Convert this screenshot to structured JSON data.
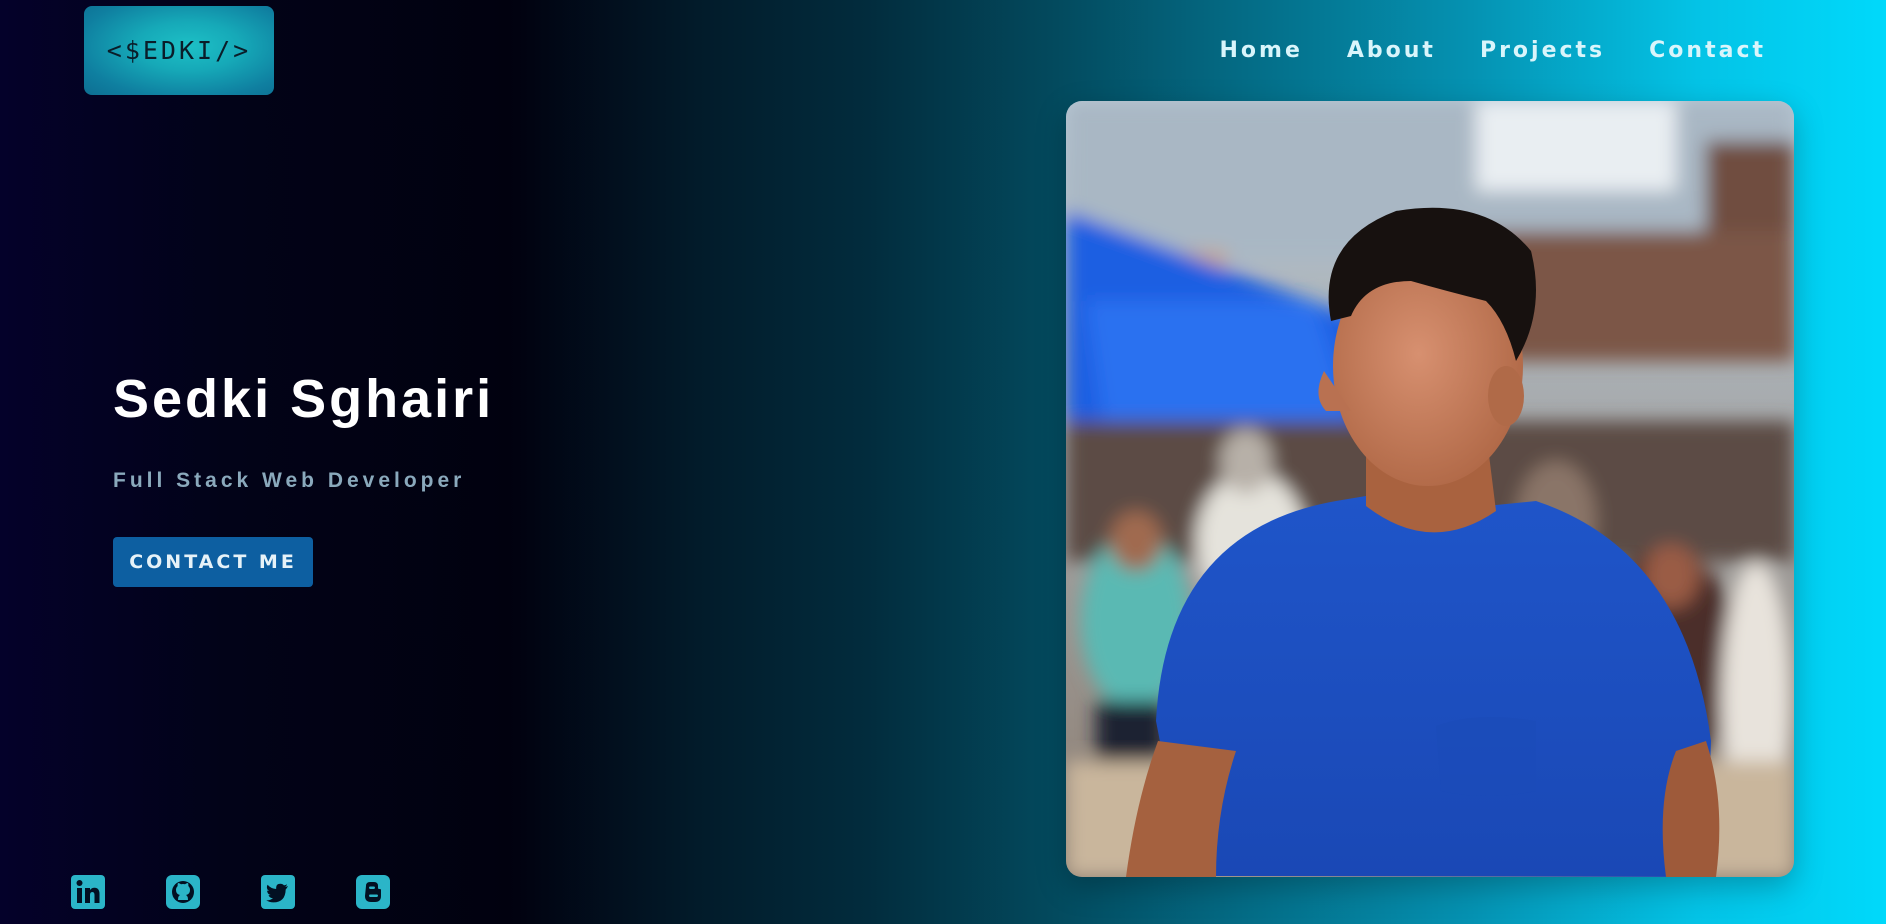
{
  "logo": {
    "text": "<$EDKI/>"
  },
  "nav": {
    "items": [
      {
        "label": "Home"
      },
      {
        "label": "About"
      },
      {
        "label": "Projects"
      },
      {
        "label": "Contact"
      }
    ]
  },
  "hero": {
    "name": "Sedki Sghairi",
    "subtitle": "Full Stack Web Developer",
    "cta_label": "CONTACT ME"
  },
  "profile_photo": {
    "subject": "man in blue t-shirt on a crowded street"
  },
  "socials": [
    {
      "icon": "linkedin-icon"
    },
    {
      "icon": "github-icon"
    },
    {
      "icon": "twitter-icon"
    },
    {
      "icon": "blogger-icon"
    }
  ],
  "colors": {
    "background_start": "#04012a",
    "background_end": "#00d9fb",
    "logo_bg": "#16a9b8",
    "button_bg": "#0d5fa1",
    "nav_text": "#d9f5fb",
    "subtitle_text": "#8aa9bc",
    "social_icon": "#2bb5c8"
  }
}
